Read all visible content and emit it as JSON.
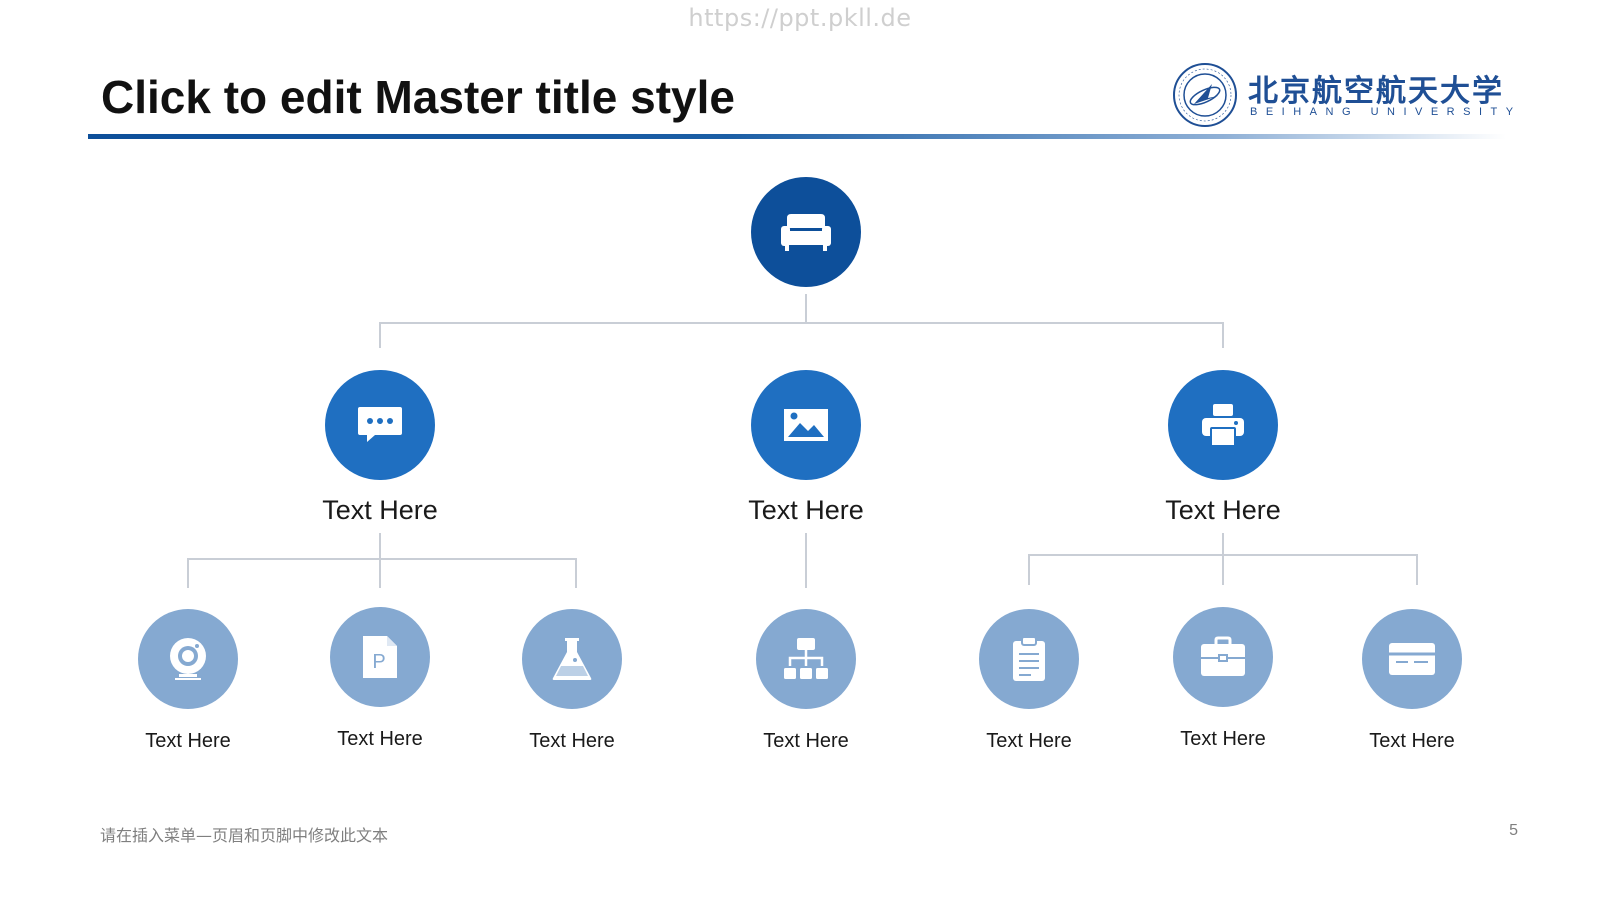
{
  "watermark": "https://ppt.pkll.de",
  "slide": {
    "title": "Click to edit Master title style",
    "footer_text": "请在插入菜单—页眉和页脚中修改此文本",
    "page_number": "5"
  },
  "logo": {
    "chinese_name": "北京航空航天大学",
    "english_name": "BEIHANG UNIVERSITY",
    "icon": "university-seal-icon",
    "color": "#1f4f95"
  },
  "colors": {
    "root": "#0d4f9a",
    "level1": "#1f6fc1",
    "level2": "#85a9d1",
    "connector": "#c9ced6",
    "title_rule": "#0d4f9a"
  },
  "hierarchy": {
    "root": {
      "icon": "sofa-icon"
    },
    "branches": [
      {
        "label": "Text Here",
        "icon": "chat-bubble-icon",
        "children": [
          {
            "label": "Text Here",
            "icon": "webcam-icon"
          },
          {
            "label": "Text Here",
            "icon": "document-p-icon"
          },
          {
            "label": "Text Here",
            "icon": "flask-icon"
          }
        ]
      },
      {
        "label": "Text Here",
        "icon": "image-icon",
        "children": [
          {
            "label": "Text Here",
            "icon": "org-chart-icon"
          }
        ]
      },
      {
        "label": "Text Here",
        "icon": "printer-icon",
        "children": [
          {
            "label": "Text Here",
            "icon": "clipboard-icon"
          },
          {
            "label": "Text Here",
            "icon": "briefcase-icon"
          },
          {
            "label": "Text Here",
            "icon": "card-icon"
          }
        ]
      }
    ]
  }
}
